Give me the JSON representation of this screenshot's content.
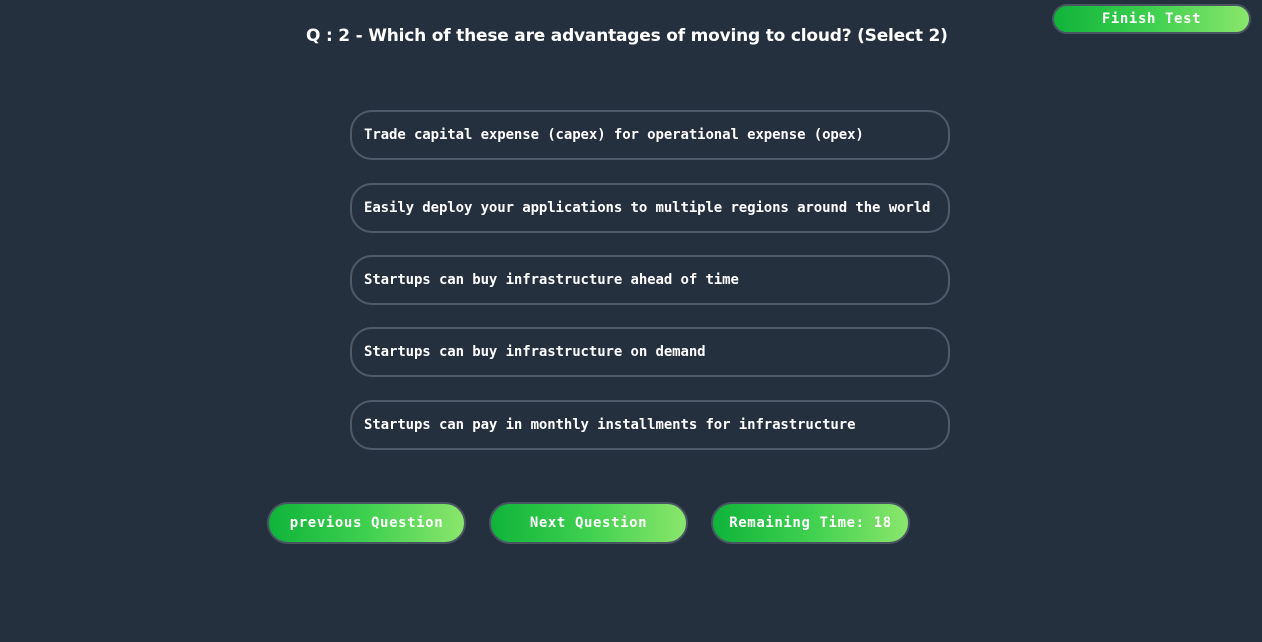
{
  "header": {
    "finish_label": "Finish Test"
  },
  "question": {
    "title": "Q : 2 - Which of these are advantages of moving to cloud? (Select 2)"
  },
  "options": [
    {
      "label": "Trade capital expense (capex) for operational expense (opex)"
    },
    {
      "label": "Easily deploy your applications to multiple regions around the world"
    },
    {
      "label": "Startups can buy infrastructure ahead of time"
    },
    {
      "label": "Startups can buy infrastructure on demand"
    },
    {
      "label": "Startups can pay in monthly installments for infrastructure"
    }
  ],
  "footer": {
    "previous_label": "previous Question",
    "next_label": "Next Question",
    "timer_text": "Remaining Time: 18"
  },
  "colors": {
    "background": "#25303e",
    "accent_green_start": "#0fb43a",
    "accent_green_end": "#8ae66c",
    "option_border": "#4f5b6a"
  }
}
